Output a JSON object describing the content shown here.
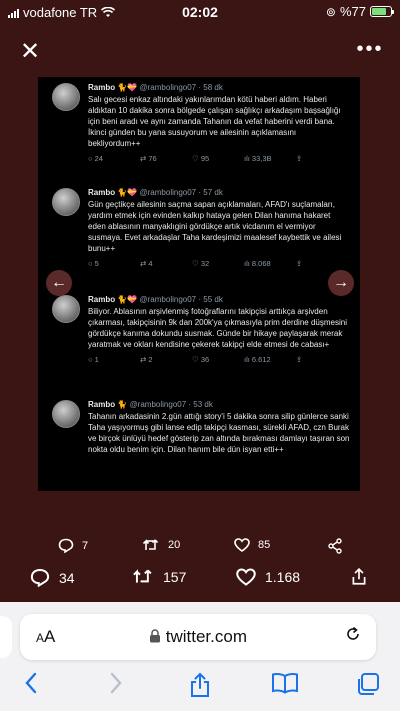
{
  "status_bar": {
    "carrier": "vodafone TR",
    "time": "02:02",
    "battery_label": "%77",
    "battery_level": 0.77
  },
  "tweets": [
    {
      "name": "Rambo",
      "emoji": "🐈💝",
      "handle": "@rambolingo07",
      "time": "· 58 dk",
      "text": "Salı gecesi enkaz altındaki yakınlarımdan kötü haberi aldım. Haberi aldıktan 10 dakika sonra bölgede çalışan sağlıkçı arkadaşım başsağlığı için beni aradı ve aynı zamanda Tahanın da vefat haberini verdi bana. İkinci günden bu yana susuyorum ve ailesinin açıklamasını bekliyordum++",
      "replies": "24",
      "retweets": "76",
      "likes": "95",
      "views": "33,3B"
    },
    {
      "name": "Rambo",
      "emoji": "🐈💝",
      "handle": "@rambolingo07",
      "time": "· 57 dk",
      "text": "Gün geçtikçe ailesinin saçma sapan açıklamaları, AFAD'ı suçlamaları, yardım etmek için evinden kalkıp hataya gelen Dilan hanıma hakaret eden ablasının manyaklıgini gördükçe artık vicdanım el vermiyor susmaya. Evet arkadaşlar Taha kardeşimizi maalesef kaybettik ve ailesi bunu++",
      "replies": "5",
      "retweets": "4",
      "likes": "32",
      "views": "8.068"
    },
    {
      "name": "Rambo",
      "emoji": "🐈💝",
      "handle": "@rambolingo07",
      "time": "· 55 dk",
      "text": "Biliyor. Ablasının arşivlenmiş fotoğraflarını takipçisi arttıkça arşivden çıkarması, takipçisinin 9k dan 200k'ya çıkmasıyla prim derdine düşmesini gördükçe kanıma dokundu susmak. Günde bir hikaye paylaşarak merak yaratmak ve okları kendisine çekerek takipçi elde etmesi de cabası+",
      "replies": "1",
      "retweets": "2",
      "likes": "36",
      "views": "6.612"
    },
    {
      "name": "Rambo",
      "emoji": "🐈",
      "handle": "@rambolingo07",
      "time": "· 53 dk",
      "text": "Tahanın arkadasinin 2.gün attığı story'i 5 dakika sonra silip günlerce sanki Taha yaşıyormuş gibi lanse edip takipçi kasması, sürekli AFAD, czn Burak ve birçok ünlüyü hedef gösterip zan altında bırakması damlayı taşıran son nokta oldu benim için. Dilan hanım bile dün isyan etti++"
    }
  ],
  "viewer_actions": {
    "replies": "7",
    "retweets": "20",
    "likes": "85"
  },
  "page_actions": {
    "replies": "34",
    "retweets": "157",
    "likes": "1.168"
  },
  "browser": {
    "aa_label_small": "A",
    "aa_label_large": "A",
    "domain": "twitter.com"
  },
  "icons": [
    "close-icon",
    "more-icon",
    "reply-icon",
    "retweet-icon",
    "like-icon",
    "views-icon",
    "share-icon",
    "lock-icon",
    "reload-icon",
    "back-icon",
    "forward-icon",
    "bookmarks-icon",
    "tabs-icon"
  ]
}
